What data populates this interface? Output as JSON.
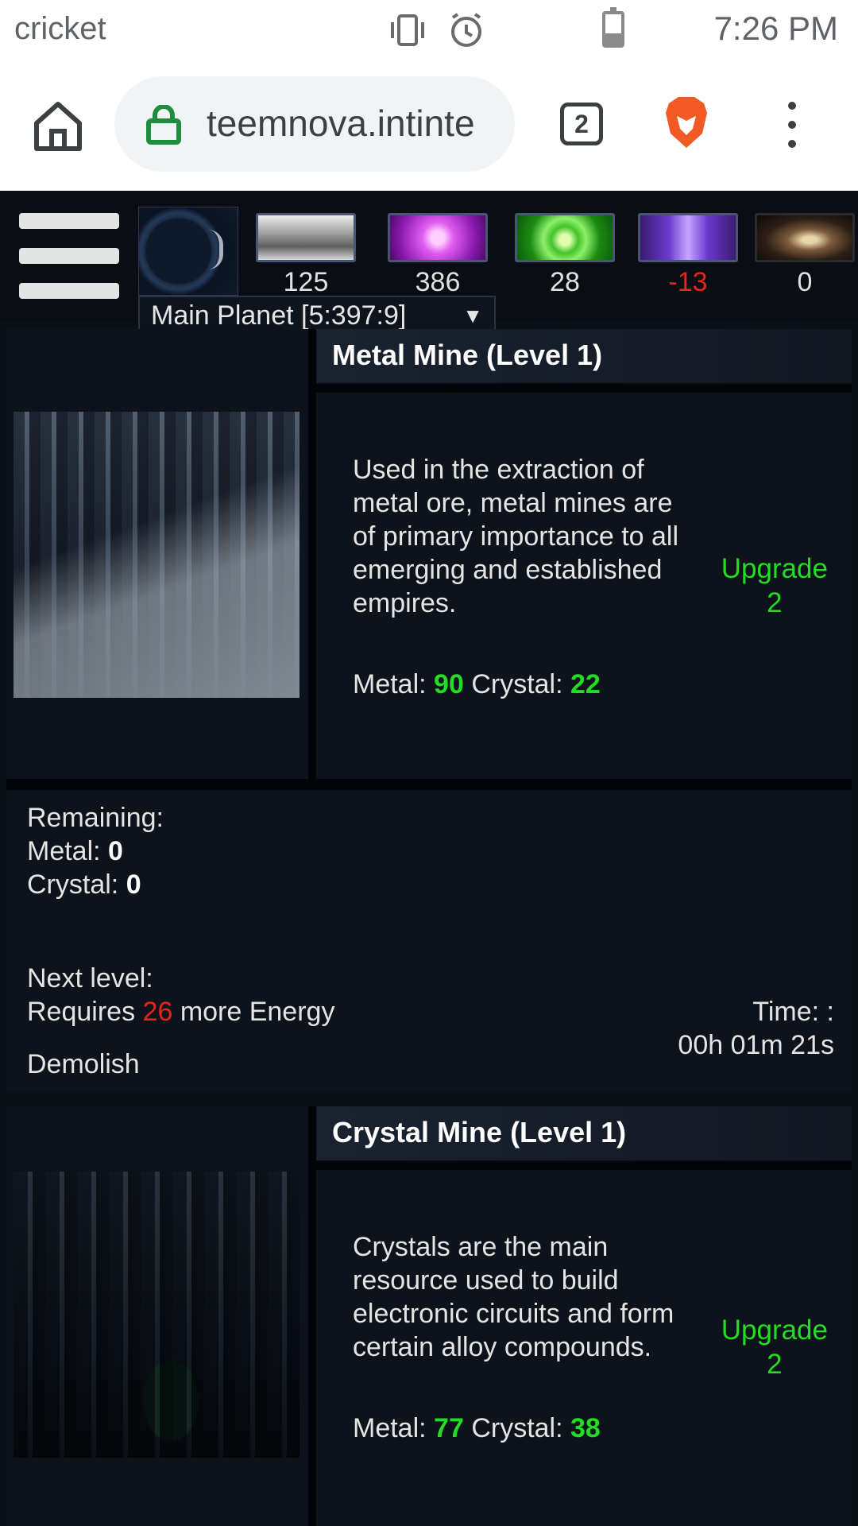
{
  "status_bar": {
    "carrier": "cricket",
    "time": "7:26 PM"
  },
  "browser": {
    "url": "teemnova.intinte",
    "tab_count": "2"
  },
  "game": {
    "resources": [
      {
        "name": "metal",
        "value": "125"
      },
      {
        "name": "crystal",
        "value": "386"
      },
      {
        "name": "deuterium",
        "value": "28"
      },
      {
        "name": "energy",
        "value": "-13",
        "color": "#e8231a"
      },
      {
        "name": "dark-matter",
        "value": "0"
      }
    ],
    "planet_select": {
      "selected": "Main Planet [5:397:9]",
      "arrow": "▼"
    },
    "buildings": [
      {
        "title": "Metal Mine (Level 1)",
        "description": "Used in the extraction of metal ore, metal mines are of primary importance to all emerging and established empires.",
        "cost_metal_label": "Metal:",
        "cost_metal": "90",
        "cost_crystal_label": "Crystal:",
        "cost_crystal": "22",
        "upgrade_label": "Upgrade",
        "upgrade_level": "2"
      },
      {
        "title": "Crystal Mine (Level 1)",
        "description": "Crystals are the main resource used to build electronic circuits and form certain alloy compounds.",
        "cost_metal_label": "Metal:",
        "cost_metal": "77",
        "cost_crystal_label": "Crystal:",
        "cost_crystal": "38",
        "upgrade_label": "Upgrade",
        "upgrade_level": "2"
      }
    ],
    "remaining": {
      "heading": "Remaining:",
      "metal_label": "Metal:",
      "metal": "0",
      "crystal_label": "Crystal:",
      "crystal": "0",
      "next_level": "Next level:",
      "requires_prefix": "Requires",
      "requires_amount": "26",
      "requires_suffix": "more Energy",
      "time_label": "Time: :",
      "time_value": "00h 01m 21s",
      "demolish": "Demolish"
    },
    "colors": {
      "accent_green": "#22dd22",
      "negative_red": "#e8231a",
      "panel_bg": "#0e131b"
    }
  }
}
